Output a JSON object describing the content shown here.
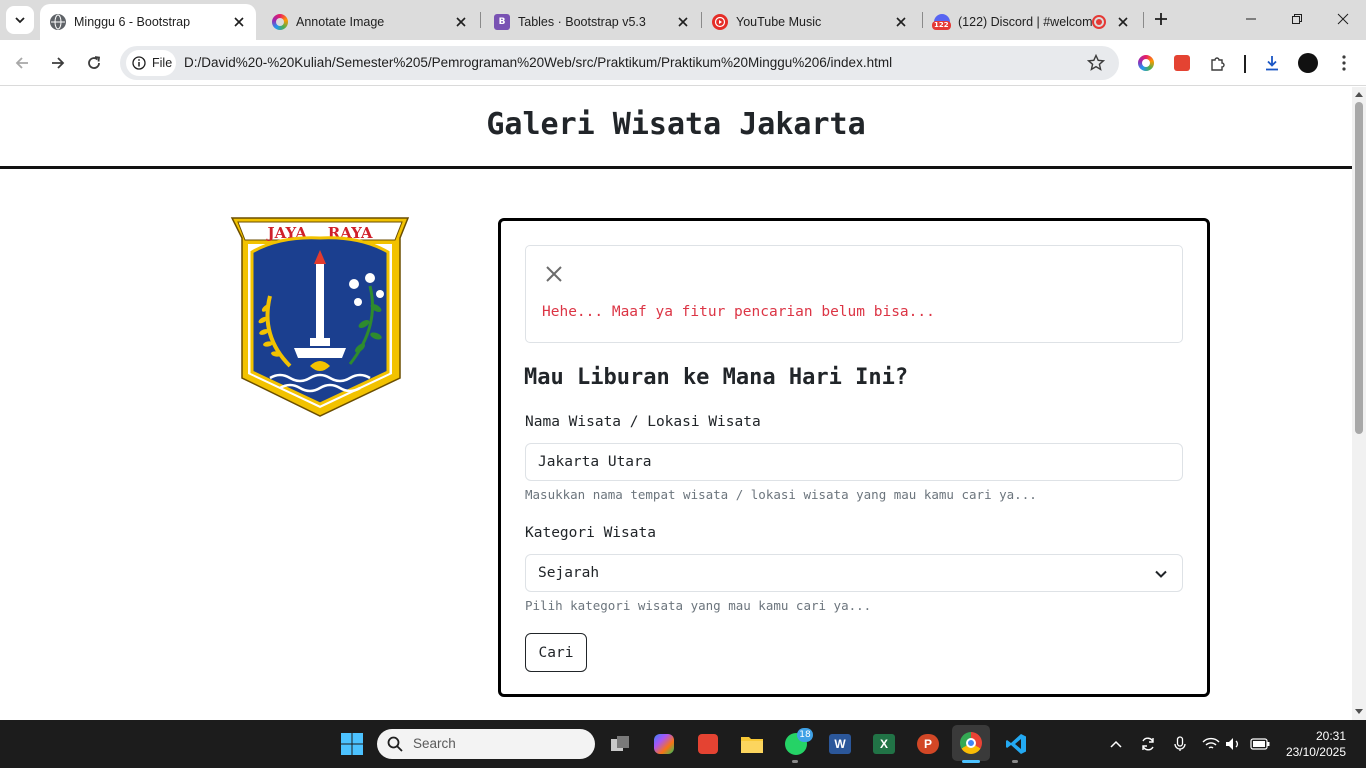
{
  "browser": {
    "tabs": [
      {
        "title": "Minggu 6 - Bootstrap",
        "active": true,
        "favicon": "globe-icon"
      },
      {
        "title": "Annotate Image",
        "active": false,
        "favicon": "annotate-icon"
      },
      {
        "title": "Tables · Bootstrap v5.3",
        "active": false,
        "favicon": "bootstrap-icon",
        "favicon_text": "B"
      },
      {
        "title": "YouTube Music",
        "active": false,
        "favicon": "youtube-music-icon"
      },
      {
        "title": "(122) Discord | #welcom",
        "active": false,
        "favicon": "discord-icon",
        "favicon_badge": "122"
      }
    ],
    "address": {
      "scheme_label": "File",
      "url": "D:/David%20-%20Kuliah/Semester%205/Pemrograman%20Web/src/Praktikum/Praktikum%20Minggu%206/index.html"
    }
  },
  "page": {
    "title": "Galeri Wisata Jakarta",
    "logo_text": "JAYA RAYA",
    "alert": {
      "message": "Hehe... Maaf ya fitur pencarian belum bisa..."
    },
    "form": {
      "heading": "Mau Liburan ke Mana Hari Ini?",
      "name_label": "Nama Wisata / Lokasi Wisata",
      "name_value": "Jakarta Utara",
      "name_help": "Masukkan nama tempat wisata / lokasi wisata yang mau kamu cari ya...",
      "category_label": "Kategori Wisata",
      "category_value": "Sejarah",
      "category_help": "Pilih kategori wisata yang mau kamu cari ya...",
      "submit_label": "Cari"
    }
  },
  "taskbar": {
    "search_placeholder": "Search",
    "whatsapp_badge": "18",
    "time": "20:31",
    "date": "23/10/2025"
  },
  "colors": {
    "alert_text": "#dc3545",
    "help_text": "#6c757d",
    "card_border": "#000000",
    "logo_shield_blue": "#1b3f8f",
    "logo_gold": "#f2c200"
  }
}
